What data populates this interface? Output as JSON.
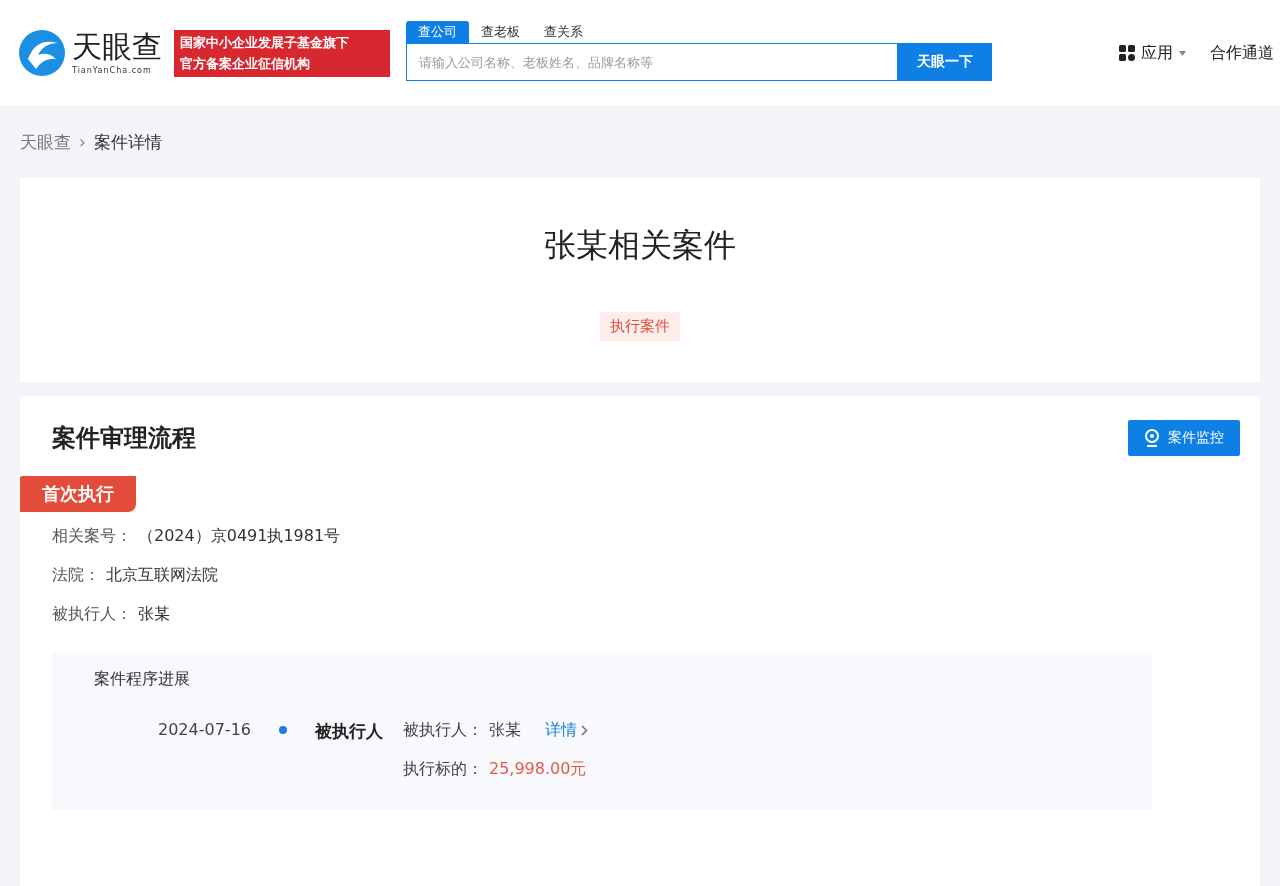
{
  "header": {
    "logo": {
      "name": "天眼查",
      "domain": "TianYanCha.com"
    },
    "badge": {
      "line1": "国家中小企业发展子基金旗下",
      "line2": "官方备案企业征信机构"
    },
    "search_tabs": [
      {
        "label": "查公司",
        "selected": true
      },
      {
        "label": "查老板",
        "selected": false
      },
      {
        "label": "查关系",
        "selected": false
      }
    ],
    "search": {
      "placeholder": "请输入公司名称、老板姓名、品牌名称等",
      "button": "天眼一下"
    },
    "nav": [
      {
        "kind": "menu",
        "label": "应用"
      },
      {
        "kind": "link",
        "label": "合作通道"
      }
    ]
  },
  "breadcrumb": [
    {
      "label": "天眼查"
    },
    {
      "label": "案件详情"
    }
  ],
  "breadcrumb_separator": "›",
  "case_header": {
    "title": "张某相关案件",
    "tag": "执行案件"
  },
  "process": {
    "title": "案件审理流程",
    "monitor_button": "案件监控",
    "stage": "首次执行",
    "fields": [
      {
        "label": "相关案号：",
        "value": "（2024）京0491执1981号"
      },
      {
        "label": "法院：",
        "value": "北京互联网法院"
      },
      {
        "label": "被执行人：",
        "value": "张某"
      }
    ],
    "progress": {
      "title": "案件程序进展",
      "events": [
        {
          "date": "2024-07-16",
          "type": "被执行人",
          "party_label": "被执行人：",
          "party": "张某",
          "detail_link": "详情",
          "amount_label": "执行标的：",
          "amount": "25,998.00元"
        }
      ]
    }
  }
}
